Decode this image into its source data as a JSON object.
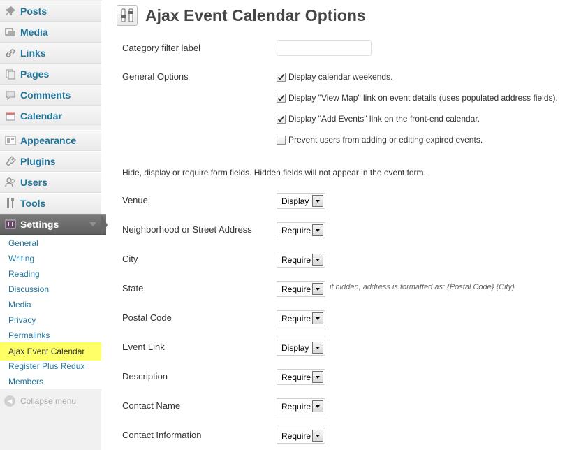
{
  "sidebar": {
    "menu": [
      {
        "label": "Posts",
        "icon": "pin-icon"
      },
      {
        "label": "Media",
        "icon": "media-icon"
      },
      {
        "label": "Links",
        "icon": "link-icon"
      },
      {
        "label": "Pages",
        "icon": "pages-icon"
      },
      {
        "label": "Comments",
        "icon": "comments-icon"
      },
      {
        "label": "Calendar",
        "icon": "calendar-icon"
      },
      {
        "label": "Appearance",
        "icon": "appearance-icon"
      },
      {
        "label": "Plugins",
        "icon": "plugins-icon"
      },
      {
        "label": "Users",
        "icon": "users-icon"
      },
      {
        "label": "Tools",
        "icon": "tools-icon"
      },
      {
        "label": "Settings",
        "icon": "settings-icon"
      }
    ],
    "submenu": [
      {
        "label": "General"
      },
      {
        "label": "Writing"
      },
      {
        "label": "Reading"
      },
      {
        "label": "Discussion"
      },
      {
        "label": "Media"
      },
      {
        "label": "Privacy"
      },
      {
        "label": "Permalinks"
      },
      {
        "label": "Ajax Event Calendar"
      },
      {
        "label": "Register Plus Redux"
      },
      {
        "label": "Members"
      }
    ],
    "collapse_label": "Collapse menu"
  },
  "main": {
    "title": "Ajax Event Calendar Options",
    "category_filter_label": "Category filter label",
    "category_filter_value": "",
    "general_options_label": "General Options",
    "options": [
      {
        "label": "Display calendar weekends.",
        "checked": true
      },
      {
        "label": "Display \"View Map\" link on event details (uses populated address fields).",
        "checked": true
      },
      {
        "label": "Display \"Add Events\" link on the front-end calendar.",
        "checked": true
      },
      {
        "label": "Prevent users from adding or editing expired events.",
        "checked": false
      }
    ],
    "intro": "Hide, display or require form fields. Hidden fields will not appear in the event form.",
    "fields": [
      {
        "label": "Venue",
        "value": "Display"
      },
      {
        "label": "Neighborhood or Street Address",
        "value": "Require"
      },
      {
        "label": "City",
        "value": "Require"
      },
      {
        "label": "State",
        "value": "Require"
      },
      {
        "label": "Postal Code",
        "value": "Require"
      },
      {
        "label": "Event Link",
        "value": "Display"
      },
      {
        "label": "Description",
        "value": "Require"
      },
      {
        "label": "Contact Name",
        "value": "Require"
      },
      {
        "label": "Contact Information",
        "value": "Require"
      }
    ],
    "state_hint": "if hidden, address is formatted as: {Postal Code} {City}"
  },
  "colors": {
    "link": "#21759b",
    "highlight": "#ffff66",
    "active_menu": "#6d6d6d"
  }
}
